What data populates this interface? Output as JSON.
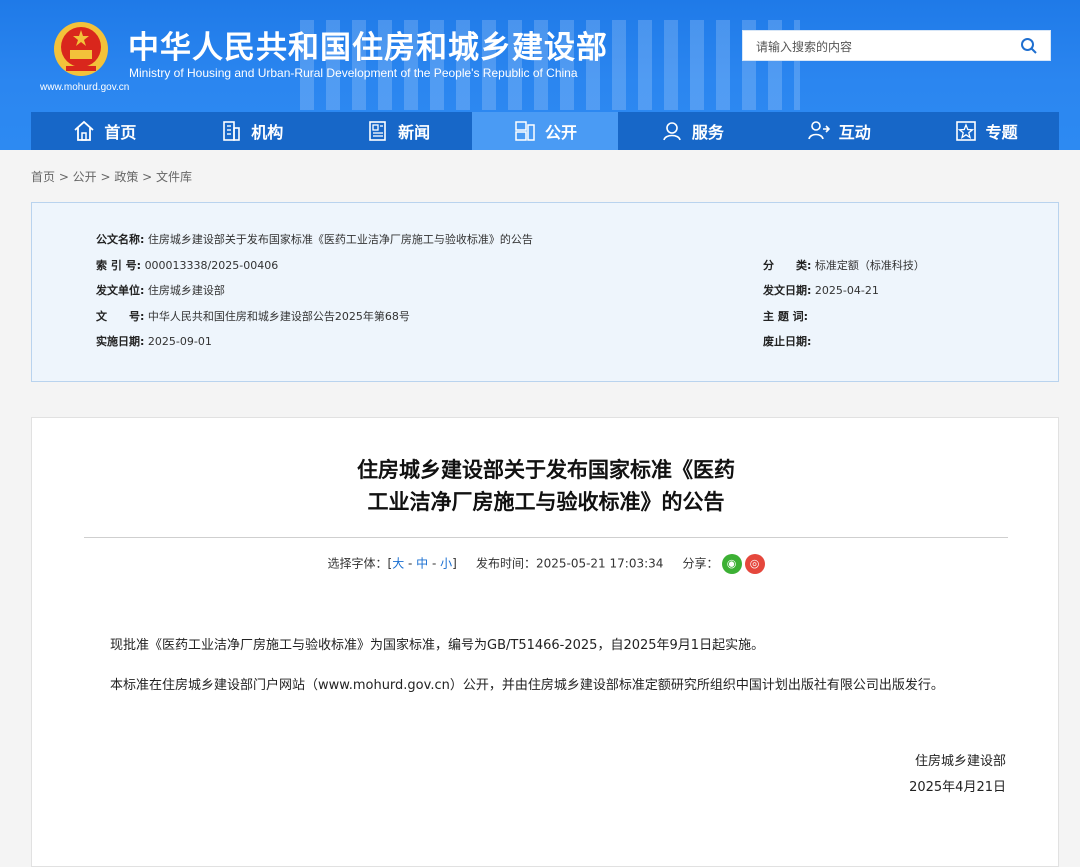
{
  "header": {
    "title_cn": "中华人民共和国住房和城乡建设部",
    "title_en": "Ministry of Housing and Urban-Rural Development of the People's Republic of China",
    "site_url": "www.mohurd.gov.cn",
    "search_placeholder": "请输入搜索的内容",
    "bg_color": "#2b86f0"
  },
  "nav": {
    "items": [
      {
        "label": "首页",
        "icon": "home-icon"
      },
      {
        "label": "机构",
        "icon": "building-icon"
      },
      {
        "label": "新闻",
        "icon": "news-icon"
      },
      {
        "label": "公开",
        "icon": "document-icon"
      },
      {
        "label": "服务",
        "icon": "service-icon"
      },
      {
        "label": "互动",
        "icon": "interact-icon"
      },
      {
        "label": "专题",
        "icon": "star-icon"
      }
    ],
    "active_index": 3
  },
  "breadcrumb": "首页 > 公开 > 政策 > 文件库",
  "meta": {
    "doc_name_label": "公文名称:",
    "doc_name": "住房城乡建设部关于发布国家标准《医药工业洁净厂房施工与验收标准》的公告",
    "index_label": "索 引 号:",
    "index": "000013338/2025-00406",
    "issuer_label": "发文单位:",
    "issuer": "住房城乡建设部",
    "docno_label": "文　　号:",
    "docno": "中华人民共和国住房和城乡建设部公告2025年第68号",
    "effective_label": "实施日期:",
    "effective": "2025-09-01",
    "category_label": "分　　类:",
    "category": "标准定额（标准科技）",
    "issue_date_label": "发文日期:",
    "issue_date": "2025-04-21",
    "keywords_label": "主 题 词:",
    "keywords": "",
    "expire_label": "废止日期:",
    "expire": ""
  },
  "article": {
    "title_line1": "住房城乡建设部关于发布国家标准《医药",
    "title_line2": "工业洁净厂房施工与验收标准》的公告",
    "font_label": "选择字体：[",
    "font_large": "大",
    "font_mid": "中",
    "font_small": "小",
    "font_end": "]",
    "publish_label": "发布时间：",
    "publish_time": "2025-05-21 17:03:34",
    "share_label": "分享：",
    "para1": "现批准《医药工业洁净厂房施工与验收标准》为国家标准，编号为GB/T51466-2025，自2025年9月1日起实施。",
    "para2": "本标准在住房城乡建设部门户网站（www.mohurd.gov.cn）公开，并由住房城乡建设部标准定额研究所组织中国计划出版社有限公司出版发行。",
    "sign_org": "住房城乡建设部",
    "sign_date": "2025年4月21日"
  }
}
